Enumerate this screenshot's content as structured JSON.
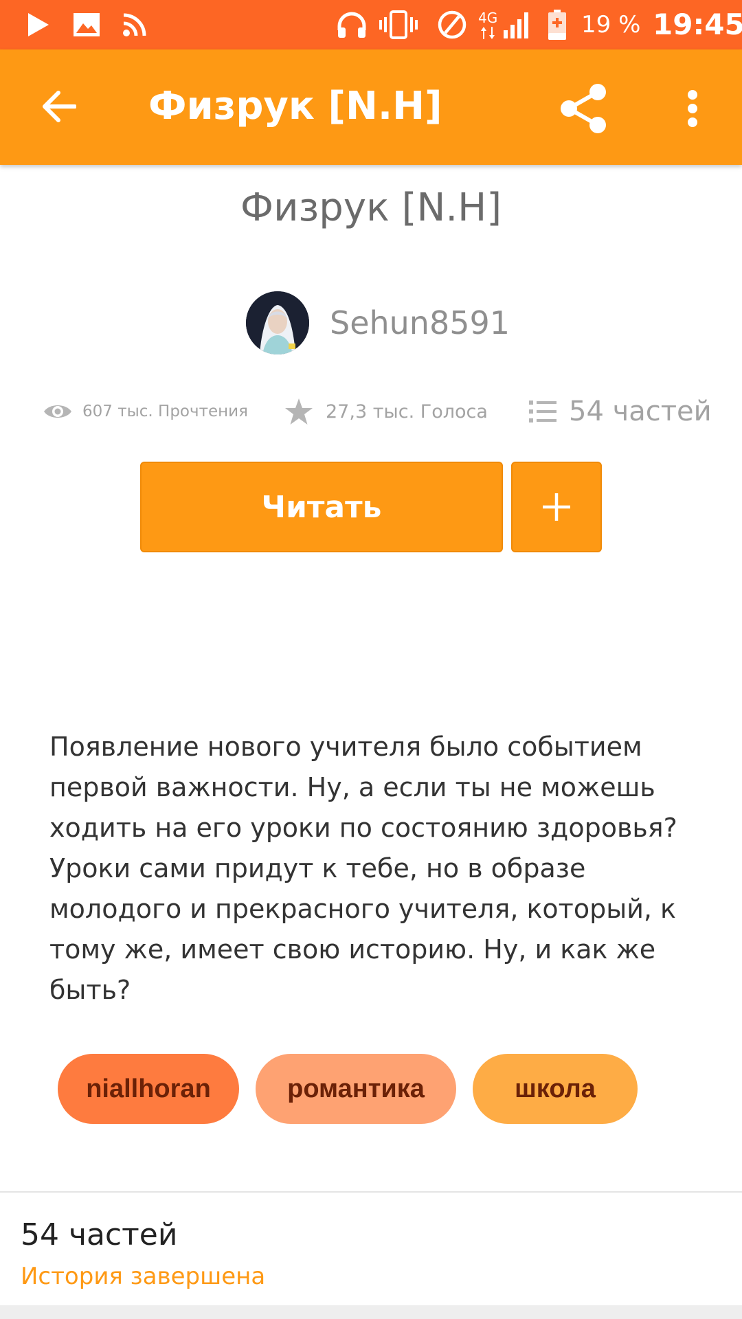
{
  "status_bar": {
    "battery": "19 %",
    "time": "19:45",
    "network_type": "4G",
    "icons": [
      "play-store-icon",
      "gallery-icon",
      "rss-icon",
      "headphones-icon",
      "vibrate-icon",
      "do-not-disturb-icon",
      "signal-icon",
      "battery-charging-icon"
    ]
  },
  "app_bar": {
    "title": "Физрук [N.H]",
    "back_icon": "arrow-left-icon",
    "share_icon": "share-icon",
    "more_icon": "more-vertical-icon"
  },
  "story": {
    "title": "Физрук [N.H]",
    "author": "Sehun8591",
    "stats": {
      "reads": "607 тыс. Прочтения",
      "votes": "27,3 тыс. Голоса",
      "parts": "54 частей"
    },
    "read_button": "Читать",
    "add_button": "+",
    "description": "Появление нового учителя было событием первой важности. Ну, а если ты не можешь ходить на его уроки по состоянию здоровья? Уроки сами придут к тебе, но в образе молодого и прекрасного учителя, который, к тому же, имеет свою историю. Ну, и как же быть?",
    "tags": [
      {
        "label": "niallhoran",
        "color": "#fe7b3f"
      },
      {
        "label": "романтика",
        "color": "#fea272"
      },
      {
        "label": "школа",
        "color": "#feac45"
      }
    ]
  },
  "parts_section": {
    "count": "54 частей",
    "status": "История завершена"
  },
  "colors": {
    "status_bar": "#fd6624",
    "accent": "#fe9914",
    "tag_text": "#6b2107"
  }
}
